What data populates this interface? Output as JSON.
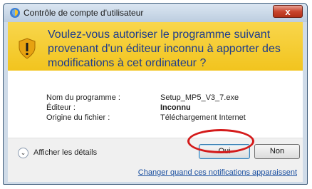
{
  "window": {
    "title": "Contrôle de compte d'utilisateur",
    "close_label": "x"
  },
  "banner": {
    "question": "Voulez-vous autoriser le programme suivant provenant d'un éditeur inconnu à apporter des modifications à cet ordinateur ?",
    "colors": {
      "background": "#f4c62a",
      "text": "#1e3c8c"
    },
    "icon": "shield-warning-icon"
  },
  "details": {
    "program_label": "Nom du programme :",
    "program_value": "Setup_MP5_V3_7.exe",
    "publisher_label": "Éditeur :",
    "publisher_value": "Inconnu",
    "origin_label": "Origine du fichier :",
    "origin_value": "Téléchargement Internet"
  },
  "footer": {
    "show_details": "Afficher les détails",
    "yes_button": "Oui",
    "no_button": "Non",
    "notification_link": "Changer quand ces notifications apparaissent"
  },
  "annotation": {
    "color": "#d41a1a",
    "target": "Oui"
  }
}
